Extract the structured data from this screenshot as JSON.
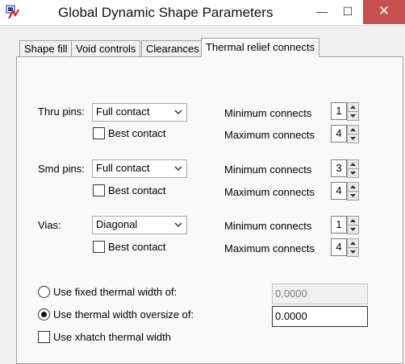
{
  "window": {
    "title": "Global Dynamic Shape Parameters",
    "minimize_glyph": "—",
    "maximize_glyph": "☐",
    "close_glyph": "✕",
    "icon": "app-logo-icon"
  },
  "tabs": [
    {
      "label": "Shape fill"
    },
    {
      "label": "Void controls"
    },
    {
      "label": "Clearances"
    },
    {
      "label": "Thermal relief connects",
      "active": true
    }
  ],
  "groups": {
    "thru": {
      "label": "Thru pins:",
      "connect": "Full contact",
      "best_contact": "Best contact",
      "min_label": "Minimum connects",
      "min": "1",
      "max_label": "Maximum connects",
      "max": "4"
    },
    "smd": {
      "label": "Smd pins:",
      "connect": "Full contact",
      "best_contact": "Best contact",
      "min_label": "Minimum connects",
      "min": "3",
      "max_label": "Maximum connects",
      "max": "4"
    },
    "vias": {
      "label": "Vias:",
      "connect": "Diagonal",
      "best_contact": "Best contact",
      "min_label": "Minimum connects",
      "min": "1",
      "max_label": "Maximum connects",
      "max": "4"
    }
  },
  "width": {
    "fixed_label": "Use fixed thermal width of:",
    "fixed_value": "0.0000",
    "oversize_label": "Use thermal width oversize of:",
    "oversize_value": "0.0000",
    "xhatch_label": "Use xhatch thermal width"
  }
}
